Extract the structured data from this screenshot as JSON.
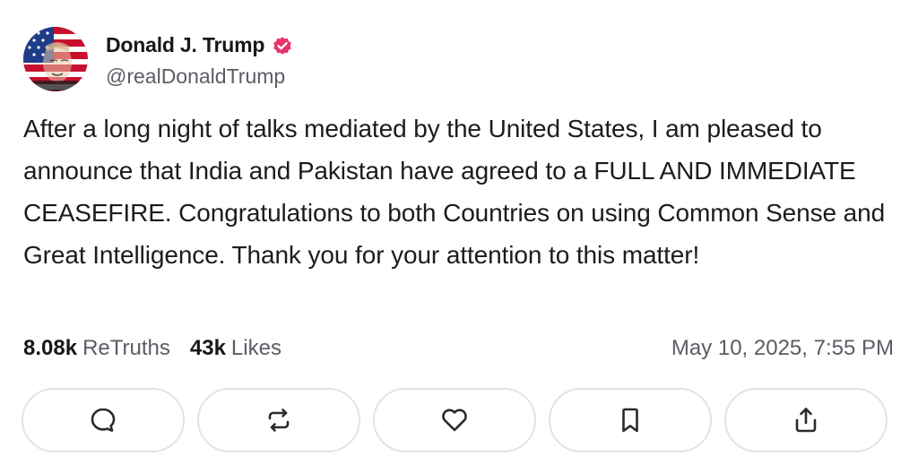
{
  "author": {
    "display_name": "Donald J. Trump",
    "handle": "@realDonaldTrump",
    "verified_icon": "verified-badge-icon",
    "verified_color": "#e8336b"
  },
  "post": {
    "text": "After a long night of talks mediated by the United States, I am pleased to announce that India and Pakistan have agreed to a FULL AND IMMEDIATE CEASEFIRE. Congratulations to both Countries on using Common Sense and Great Intelligence. Thank you for your attention to this matter!",
    "timestamp": "May 10, 2025, 7:55 PM"
  },
  "stats": {
    "retruths_count": "8.08k",
    "retruths_label": "ReTruths",
    "likes_count": "43k",
    "likes_label": "Likes"
  },
  "actions": [
    {
      "name": "reply",
      "icon": "comment-icon"
    },
    {
      "name": "retruth",
      "icon": "repost-icon"
    },
    {
      "name": "like",
      "icon": "heart-icon"
    },
    {
      "name": "bookmark",
      "icon": "bookmark-icon"
    },
    {
      "name": "share",
      "icon": "share-icon"
    }
  ],
  "colors": {
    "icon": "#2a2a2e",
    "button_border": "#e3e3e8",
    "muted_text": "#5c5c66"
  }
}
